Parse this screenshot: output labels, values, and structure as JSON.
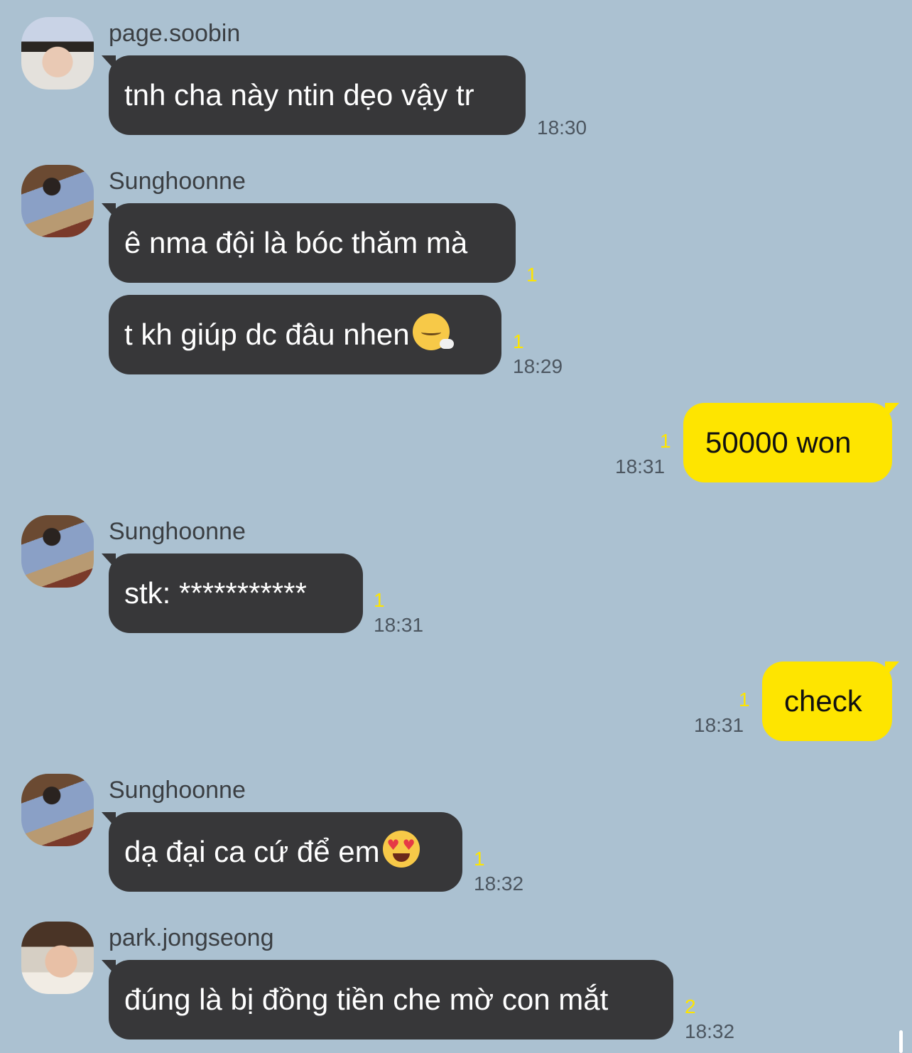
{
  "messages": [
    {
      "sender": "page.soobin",
      "text": "tnh cha này ntin dẹo vậy tr",
      "time": "18:30"
    },
    {
      "sender": "Sunghoonne",
      "text": "ê nma đội là bóc thăm mà",
      "unread": "1"
    },
    {
      "text": "t kh giúp dc đâu nhen",
      "emoji": "face-exhaling-emoji",
      "unread": "1",
      "time": "18:29"
    },
    {
      "outgoing": true,
      "text": "50000 won",
      "unread": "1",
      "time": "18:31"
    },
    {
      "sender": "Sunghoonne",
      "text": "stk: ***********",
      "unread": "1",
      "time": "18:31"
    },
    {
      "outgoing": true,
      "text": "check",
      "unread": "1",
      "time": "18:31"
    },
    {
      "sender": "Sunghoonne",
      "text": "dạ đại ca cứ để em",
      "emoji": "smiling-face-with-heart-eyes-emoji",
      "unread": "1",
      "time": "18:32"
    },
    {
      "sender": "park.jongseong",
      "text": "đúng là bị đồng tiền che mờ con mắt",
      "unread": "2",
      "time": "18:32"
    }
  ],
  "colors": {
    "background": "#abc1d1",
    "incoming_bubble": "#373739",
    "outgoing_bubble": "#fee500",
    "unread_count": "#fee500"
  }
}
